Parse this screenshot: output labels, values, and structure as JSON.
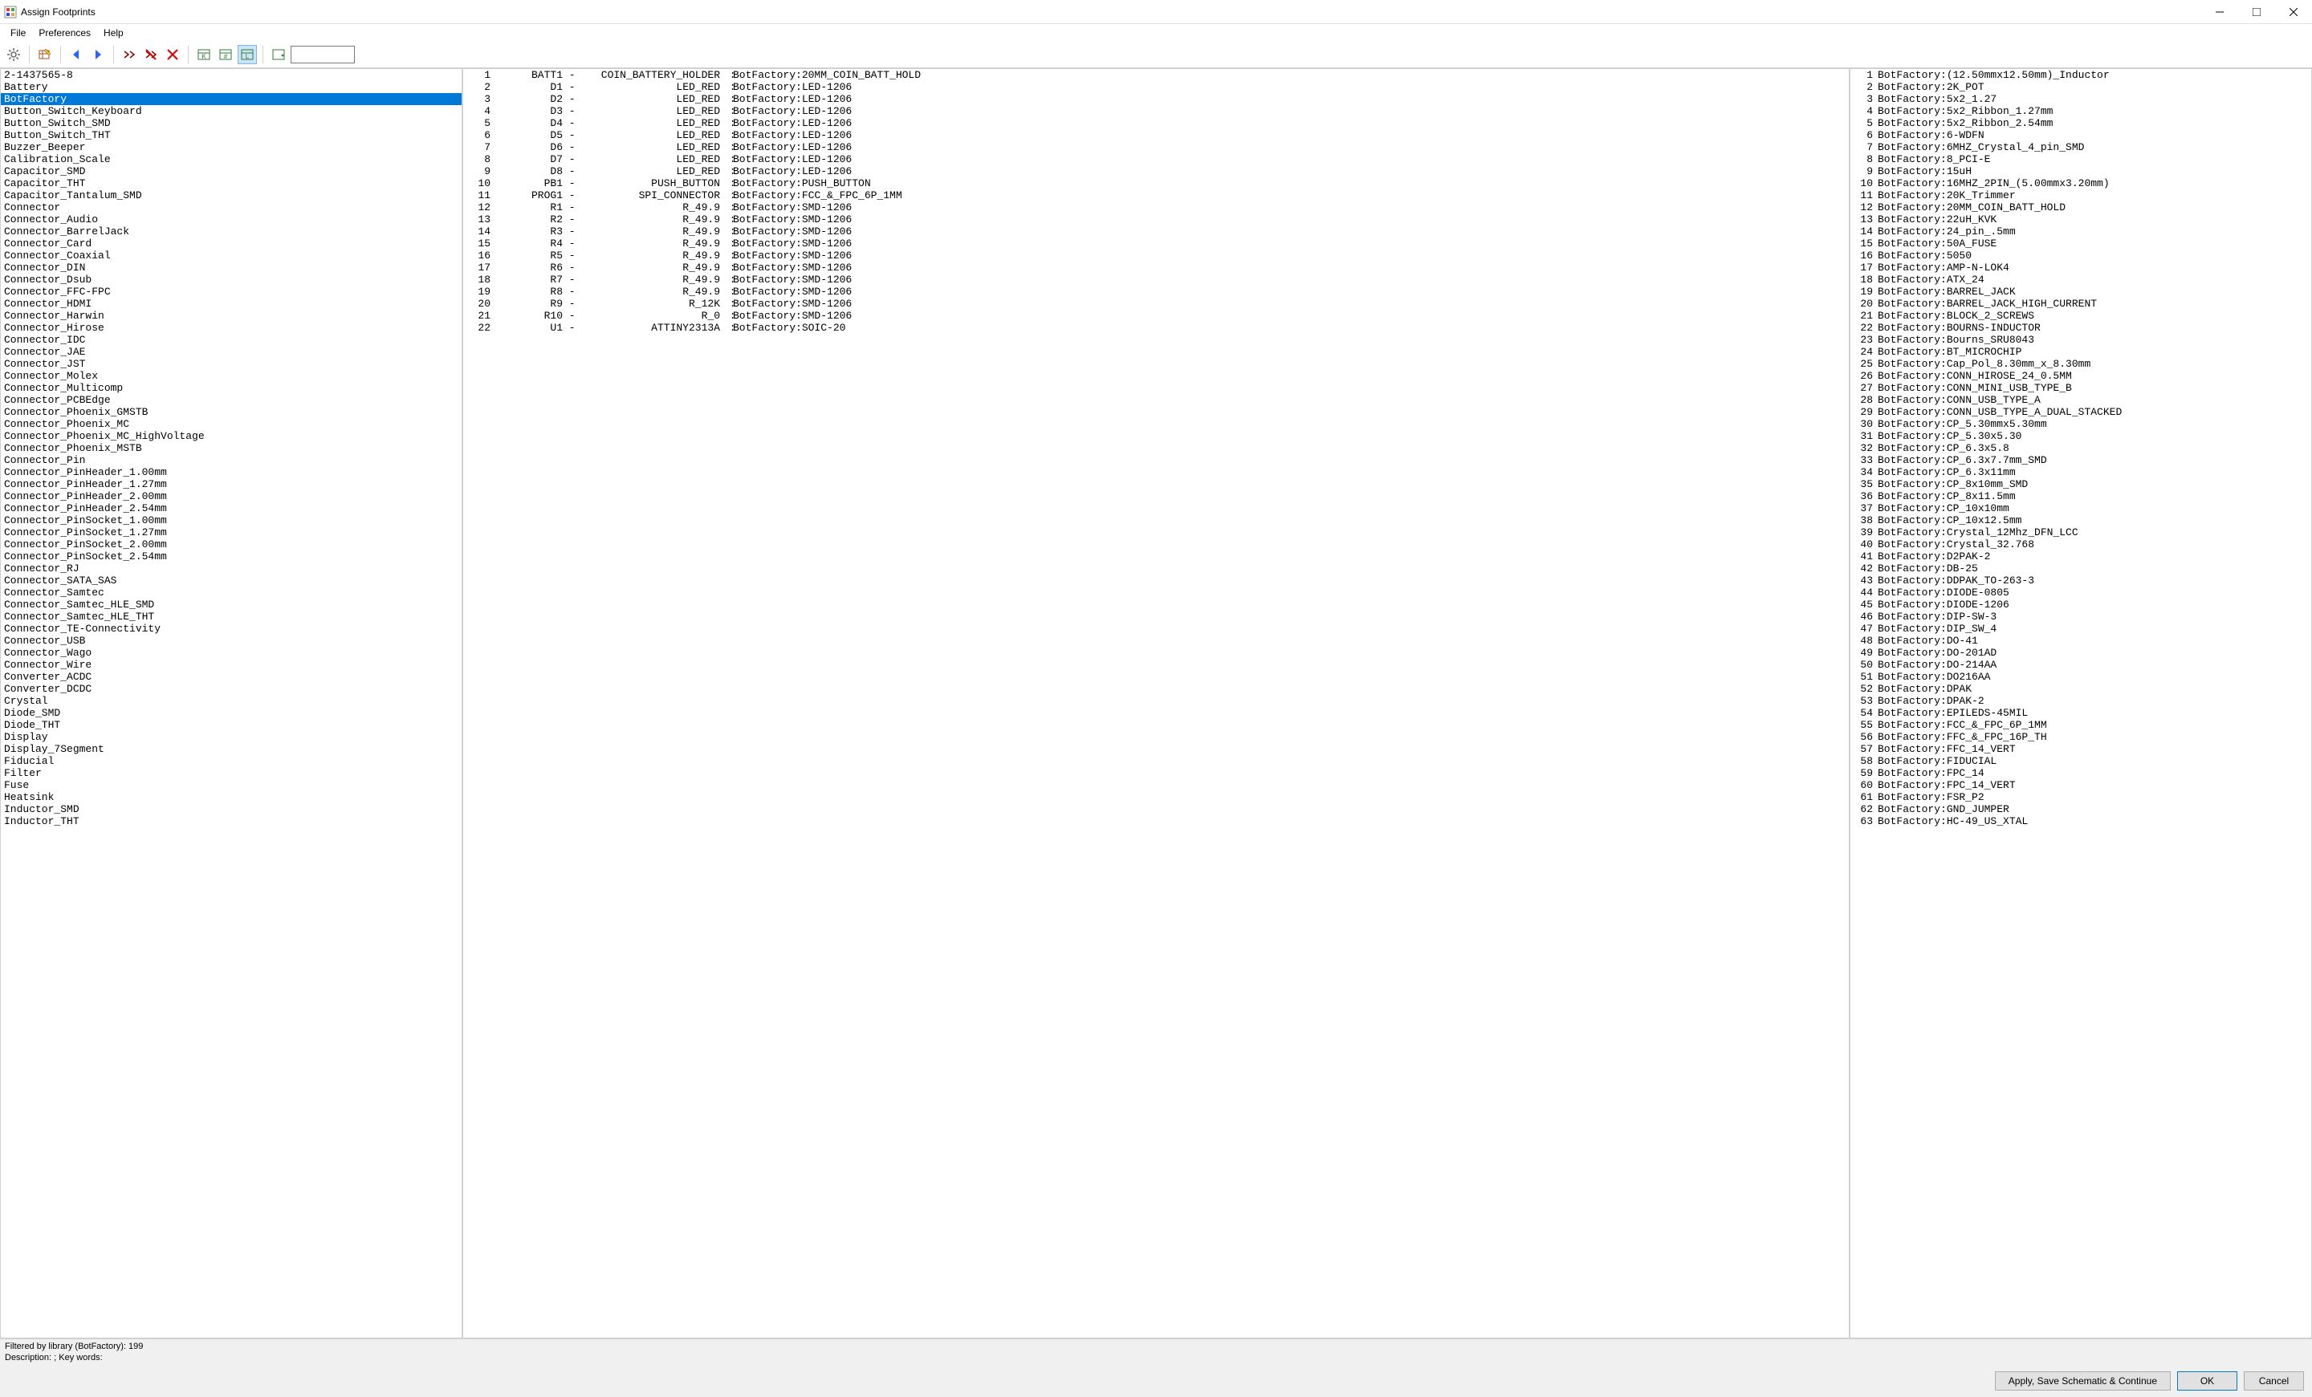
{
  "window": {
    "title": "Assign Footprints"
  },
  "menu": {
    "file": "File",
    "preferences": "Preferences",
    "help": "Help"
  },
  "libraries": {
    "selected_index": 2,
    "items": [
      "2-1437565-8",
      "Battery",
      "BotFactory",
      "Button_Switch_Keyboard",
      "Button_Switch_SMD",
      "Button_Switch_THT",
      "Buzzer_Beeper",
      "Calibration_Scale",
      "Capacitor_SMD",
      "Capacitor_THT",
      "Capacitor_Tantalum_SMD",
      "Connector",
      "Connector_Audio",
      "Connector_BarrelJack",
      "Connector_Card",
      "Connector_Coaxial",
      "Connector_DIN",
      "Connector_Dsub",
      "Connector_FFC-FPC",
      "Connector_HDMI",
      "Connector_Harwin",
      "Connector_Hirose",
      "Connector_IDC",
      "Connector_JAE",
      "Connector_JST",
      "Connector_Molex",
      "Connector_Multicomp",
      "Connector_PCBEdge",
      "Connector_Phoenix_GMSTB",
      "Connector_Phoenix_MC",
      "Connector_Phoenix_MC_HighVoltage",
      "Connector_Phoenix_MSTB",
      "Connector_Pin",
      "Connector_PinHeader_1.00mm",
      "Connector_PinHeader_1.27mm",
      "Connector_PinHeader_2.00mm",
      "Connector_PinHeader_2.54mm",
      "Connector_PinSocket_1.00mm",
      "Connector_PinSocket_1.27mm",
      "Connector_PinSocket_2.00mm",
      "Connector_PinSocket_2.54mm",
      "Connector_RJ",
      "Connector_SATA_SAS",
      "Connector_Samtec",
      "Connector_Samtec_HLE_SMD",
      "Connector_Samtec_HLE_THT",
      "Connector_TE-Connectivity",
      "Connector_USB",
      "Connector_Wago",
      "Connector_Wire",
      "Converter_ACDC",
      "Converter_DCDC",
      "Crystal",
      "Diode_SMD",
      "Diode_THT",
      "Display",
      "Display_7Segment",
      "Fiducial",
      "Filter",
      "Fuse",
      "Heatsink",
      "Inductor_SMD",
      "Inductor_THT"
    ]
  },
  "components": [
    {
      "n": 1,
      "ref": "BATT1",
      "val": "COIN_BATTERY_HOLDER",
      "fp": "BotFactory:20MM_COIN_BATT_HOLD"
    },
    {
      "n": 2,
      "ref": "D1",
      "val": "LED_RED",
      "fp": "BotFactory:LED-1206"
    },
    {
      "n": 3,
      "ref": "D2",
      "val": "LED_RED",
      "fp": "BotFactory:LED-1206"
    },
    {
      "n": 4,
      "ref": "D3",
      "val": "LED_RED",
      "fp": "BotFactory:LED-1206"
    },
    {
      "n": 5,
      "ref": "D4",
      "val": "LED_RED",
      "fp": "BotFactory:LED-1206"
    },
    {
      "n": 6,
      "ref": "D5",
      "val": "LED_RED",
      "fp": "BotFactory:LED-1206"
    },
    {
      "n": 7,
      "ref": "D6",
      "val": "LED_RED",
      "fp": "BotFactory:LED-1206"
    },
    {
      "n": 8,
      "ref": "D7",
      "val": "LED_RED",
      "fp": "BotFactory:LED-1206"
    },
    {
      "n": 9,
      "ref": "D8",
      "val": "LED_RED",
      "fp": "BotFactory:LED-1206"
    },
    {
      "n": 10,
      "ref": "PB1",
      "val": "PUSH_BUTTON",
      "fp": "BotFactory:PUSH_BUTTON"
    },
    {
      "n": 11,
      "ref": "PROG1",
      "val": "SPI_CONNECTOR",
      "fp": "BotFactory:FCC_&_FPC_6P_1MM"
    },
    {
      "n": 12,
      "ref": "R1",
      "val": "R_49.9",
      "fp": "BotFactory:SMD-1206"
    },
    {
      "n": 13,
      "ref": "R2",
      "val": "R_49.9",
      "fp": "BotFactory:SMD-1206"
    },
    {
      "n": 14,
      "ref": "R3",
      "val": "R_49.9",
      "fp": "BotFactory:SMD-1206"
    },
    {
      "n": 15,
      "ref": "R4",
      "val": "R_49.9",
      "fp": "BotFactory:SMD-1206"
    },
    {
      "n": 16,
      "ref": "R5",
      "val": "R_49.9",
      "fp": "BotFactory:SMD-1206"
    },
    {
      "n": 17,
      "ref": "R6",
      "val": "R_49.9",
      "fp": "BotFactory:SMD-1206"
    },
    {
      "n": 18,
      "ref": "R7",
      "val": "R_49.9",
      "fp": "BotFactory:SMD-1206"
    },
    {
      "n": 19,
      "ref": "R8",
      "val": "R_49.9",
      "fp": "BotFactory:SMD-1206"
    },
    {
      "n": 20,
      "ref": "R9",
      "val": "R_12K",
      "fp": "BotFactory:SMD-1206"
    },
    {
      "n": 21,
      "ref": "R10",
      "val": "R_0",
      "fp": "BotFactory:SMD-1206"
    },
    {
      "n": 22,
      "ref": "U1",
      "val": "ATTINY2313A",
      "fp": "BotFactory:SOIC-20"
    }
  ],
  "footprints": [
    "BotFactory:(12.50mmx12.50mm)_Inductor",
    "BotFactory:2K_POT",
    "BotFactory:5x2_1.27",
    "BotFactory:5x2_Ribbon_1.27mm",
    "BotFactory:5x2_Ribbon_2.54mm",
    "BotFactory:6-WDFN",
    "BotFactory:6MHZ_Crystal_4_pin_SMD",
    "BotFactory:8_PCI-E",
    "BotFactory:15uH",
    "BotFactory:16MHZ_2PIN_(5.00mmx3.20mm)",
    "BotFactory:20K_Trimmer",
    "BotFactory:20MM_COIN_BATT_HOLD",
    "BotFactory:22uH_KVK",
    "BotFactory:24_pin_.5mm",
    "BotFactory:50A_FUSE",
    "BotFactory:5050",
    "BotFactory:AMP-N-LOK4",
    "BotFactory:ATX_24",
    "BotFactory:BARREL_JACK",
    "BotFactory:BARREL_JACK_HIGH_CURRENT",
    "BotFactory:BLOCK_2_SCREWS",
    "BotFactory:BOURNS-INDUCTOR",
    "BotFactory:Bourns_SRU8043",
    "BotFactory:BT_MICROCHIP",
    "BotFactory:Cap_Pol_8.30mm_x_8.30mm",
    "BotFactory:CONN_HIROSE_24_0.5MM",
    "BotFactory:CONN_MINI_USB_TYPE_B",
    "BotFactory:CONN_USB_TYPE_A",
    "BotFactory:CONN_USB_TYPE_A_DUAL_STACKED",
    "BotFactory:CP_5.30mmx5.30mm",
    "BotFactory:CP_5.30x5.30",
    "BotFactory:CP_6.3x5.8",
    "BotFactory:CP_6.3x7.7mm_SMD",
    "BotFactory:CP_6.3x11mm",
    "BotFactory:CP_8x10mm_SMD",
    "BotFactory:CP_8x11.5mm",
    "BotFactory:CP_10x10mm",
    "BotFactory:CP_10x12.5mm",
    "BotFactory:Crystal_12Mhz_DFN_LCC",
    "BotFactory:Crystal_32.768",
    "BotFactory:D2PAK-2",
    "BotFactory:DB-25",
    "BotFactory:DDPAK_TO-263-3",
    "BotFactory:DIODE-0805",
    "BotFactory:DIODE-1206",
    "BotFactory:DIP-SW-3",
    "BotFactory:DIP_SW_4",
    "BotFactory:DO-41",
    "BotFactory:DO-201AD",
    "BotFactory:DO-214AA",
    "BotFactory:DO216AA",
    "BotFactory:DPAK",
    "BotFactory:DPAK-2",
    "BotFactory:EPILEDS-45MIL",
    "BotFactory:FCC_&_FPC_6P_1MM",
    "BotFactory:FFC_&_FPC_16P_TH",
    "BotFactory:FFC_14_VERT",
    "BotFactory:FIDUCIAL",
    "BotFactory:FPC_14",
    "BotFactory:FPC_14_VERT",
    "BotFactory:FSR_P2",
    "BotFactory:GND_JUMPER",
    "BotFactory:HC-49_US_XTAL"
  ],
  "status": {
    "filter": "Filtered by library (BotFactory): 199",
    "desc": "Description: ;  Key words:"
  },
  "buttons": {
    "apply": "Apply, Save Schematic & Continue",
    "ok": "OK",
    "cancel": "Cancel"
  }
}
